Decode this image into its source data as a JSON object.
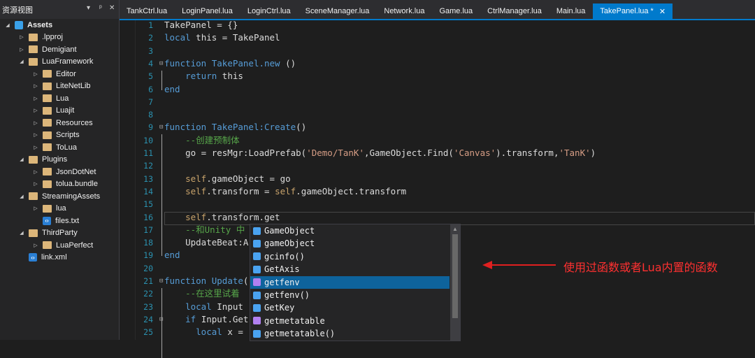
{
  "panel": {
    "title": "资源视图",
    "controls": [
      "▾",
      "ᵖ",
      "✕"
    ]
  },
  "tree": [
    {
      "label": "Assets",
      "depth": 0,
      "arrow": "◢",
      "icon": "asset",
      "bold": true
    },
    {
      "label": ".lpproj",
      "depth": 1,
      "arrow": "▷",
      "icon": "folder"
    },
    {
      "label": "Demigiant",
      "depth": 1,
      "arrow": "▷",
      "icon": "folder"
    },
    {
      "label": "LuaFramework",
      "depth": 1,
      "arrow": "◢",
      "icon": "folder"
    },
    {
      "label": "Editor",
      "depth": 2,
      "arrow": "▷",
      "icon": "folder"
    },
    {
      "label": "LiteNetLib",
      "depth": 2,
      "arrow": "▷",
      "icon": "folder"
    },
    {
      "label": "Lua",
      "depth": 2,
      "arrow": "▷",
      "icon": "folder"
    },
    {
      "label": "Luajit",
      "depth": 2,
      "arrow": "▷",
      "icon": "folder"
    },
    {
      "label": "Resources",
      "depth": 2,
      "arrow": "▷",
      "icon": "folder"
    },
    {
      "label": "Scripts",
      "depth": 2,
      "arrow": "▷",
      "icon": "folder"
    },
    {
      "label": "ToLua",
      "depth": 2,
      "arrow": "▷",
      "icon": "folder"
    },
    {
      "label": "Plugins",
      "depth": 1,
      "arrow": "◢",
      "icon": "folder"
    },
    {
      "label": "JsonDotNet",
      "depth": 2,
      "arrow": "▷",
      "icon": "folder"
    },
    {
      "label": "tolua.bundle",
      "depth": 2,
      "arrow": "▷",
      "icon": "folder"
    },
    {
      "label": "StreamingAssets",
      "depth": 1,
      "arrow": "◢",
      "icon": "folder"
    },
    {
      "label": "lua",
      "depth": 2,
      "arrow": "▷",
      "icon": "folder"
    },
    {
      "label": "files.txt",
      "depth": 2,
      "arrow": "",
      "icon": "file"
    },
    {
      "label": "ThirdParty",
      "depth": 1,
      "arrow": "◢",
      "icon": "folder"
    },
    {
      "label": "LuaPerfect",
      "depth": 2,
      "arrow": "▷",
      "icon": "folder"
    },
    {
      "label": "link.xml",
      "depth": 1,
      "arrow": "",
      "icon": "file"
    }
  ],
  "tabs": [
    {
      "label": "TankCtrl.lua",
      "active": false
    },
    {
      "label": "LoginPanel.lua",
      "active": false
    },
    {
      "label": "LoginCtrl.lua",
      "active": false
    },
    {
      "label": "SceneManager.lua",
      "active": false
    },
    {
      "label": "Network.lua",
      "active": false
    },
    {
      "label": "Game.lua",
      "active": false
    },
    {
      "label": "CtrlManager.lua",
      "active": false
    },
    {
      "label": "Main.lua",
      "active": false
    },
    {
      "label": "TakePanel.lua *",
      "active": true
    }
  ],
  "active_tab_close": "✕",
  "lines": [
    {
      "n": "1",
      "fold": "",
      "html": [
        [
          "plain",
          "TakePanel = {}"
        ]
      ]
    },
    {
      "n": "2",
      "fold": "",
      "html": [
        [
          "kw",
          "local"
        ],
        [
          "plain",
          " this = TakePanel"
        ]
      ]
    },
    {
      "n": "3",
      "fold": "",
      "html": []
    },
    {
      "n": "4",
      "fold": "⊟",
      "html": [
        [
          "kw",
          "function"
        ],
        [
          "plain",
          " "
        ],
        [
          "fn",
          "TakePanel.new"
        ],
        [
          "plain",
          " ()"
        ]
      ]
    },
    {
      "n": "5",
      "fold": "",
      "html": [
        [
          "plain",
          "    "
        ],
        [
          "kw",
          "return"
        ],
        [
          "plain",
          " this"
        ]
      ]
    },
    {
      "n": "6",
      "fold": "",
      "html": [
        [
          "kw",
          "end"
        ]
      ]
    },
    {
      "n": "7",
      "fold": "",
      "html": []
    },
    {
      "n": "8",
      "fold": "",
      "html": []
    },
    {
      "n": "9",
      "fold": "⊟",
      "html": [
        [
          "kw",
          "function"
        ],
        [
          "plain",
          " "
        ],
        [
          "fn",
          "TakePanel:Create"
        ],
        [
          "plain",
          "()"
        ]
      ]
    },
    {
      "n": "10",
      "fold": "",
      "html": [
        [
          "plain",
          "    "
        ],
        [
          "cm",
          "--创建预制体"
        ]
      ]
    },
    {
      "n": "11",
      "fold": "",
      "html": [
        [
          "plain",
          "    go = resMgr:LoadPrefab("
        ],
        [
          "str",
          "'Demo/TanK'"
        ],
        [
          "plain",
          ",GameObject.Find("
        ],
        [
          "str",
          "'Canvas'"
        ],
        [
          "plain",
          ").transform,"
        ],
        [
          "str",
          "'TanK'"
        ],
        [
          "plain",
          ")"
        ]
      ]
    },
    {
      "n": "12",
      "fold": "",
      "html": []
    },
    {
      "n": "13",
      "fold": "",
      "html": [
        [
          "plain",
          "    "
        ],
        [
          "self",
          "self"
        ],
        [
          "plain",
          ".gameObject = go"
        ]
      ]
    },
    {
      "n": "14",
      "fold": "",
      "html": [
        [
          "plain",
          "    "
        ],
        [
          "self",
          "self"
        ],
        [
          "plain",
          ".transform = "
        ],
        [
          "self",
          "self"
        ],
        [
          "plain",
          ".gameObject.transform"
        ]
      ]
    },
    {
      "n": "15",
      "fold": "",
      "html": []
    },
    {
      "n": "16",
      "fold": "",
      "html": [
        [
          "plain",
          "    "
        ],
        [
          "self",
          "self"
        ],
        [
          "plain",
          ".transform.get"
        ]
      ]
    },
    {
      "n": "17",
      "fold": "",
      "html": [
        [
          "plain",
          "    "
        ],
        [
          "cm",
          "--和Unity 中"
        ]
      ]
    },
    {
      "n": "18",
      "fold": "",
      "html": [
        [
          "plain",
          "    UpdateBeat:A"
        ]
      ]
    },
    {
      "n": "19",
      "fold": "",
      "html": [
        [
          "kw",
          "end"
        ]
      ]
    },
    {
      "n": "20",
      "fold": "",
      "html": []
    },
    {
      "n": "21",
      "fold": "⊟",
      "html": [
        [
          "kw",
          "function"
        ],
        [
          "plain",
          " "
        ],
        [
          "fn",
          "Update"
        ],
        [
          "plain",
          "("
        ]
      ]
    },
    {
      "n": "22",
      "fold": "",
      "html": [
        [
          "plain",
          "    "
        ],
        [
          "cm",
          "--在这里试着"
        ]
      ]
    },
    {
      "n": "23",
      "fold": "",
      "html": [
        [
          "plain",
          "    "
        ],
        [
          "kw",
          "local"
        ],
        [
          "plain",
          " Input"
        ]
      ]
    },
    {
      "n": "24",
      "fold": "⊟",
      "html": [
        [
          "plain",
          "    "
        ],
        [
          "kw",
          "if"
        ],
        [
          "plain",
          " Input.Get"
        ]
      ]
    },
    {
      "n": "25",
      "fold": "",
      "html": [
        [
          "plain",
          "      "
        ],
        [
          "kw",
          "local"
        ],
        [
          "plain",
          " x ="
        ]
      ]
    }
  ],
  "autocomplete": [
    {
      "label": "GameObject",
      "color": "blue",
      "selected": false
    },
    {
      "label": "gameObject",
      "color": "blue",
      "selected": false
    },
    {
      "label": "gcinfo()",
      "color": "blue",
      "selected": false
    },
    {
      "label": "GetAxis",
      "color": "blue",
      "selected": false
    },
    {
      "label": "getfenv",
      "color": "purple",
      "selected": true
    },
    {
      "label": "getfenv()",
      "color": "blue",
      "selected": false
    },
    {
      "label": "GetKey",
      "color": "blue",
      "selected": false
    },
    {
      "label": "getmetatable",
      "color": "purple",
      "selected": false
    },
    {
      "label": "getmetatable()",
      "color": "blue",
      "selected": false
    }
  ],
  "annotation": "使用过函数或者Lua内置的函数",
  "colors": {
    "accent": "#007acc",
    "annotation": "#e02020",
    "selection": "#0e639c"
  }
}
